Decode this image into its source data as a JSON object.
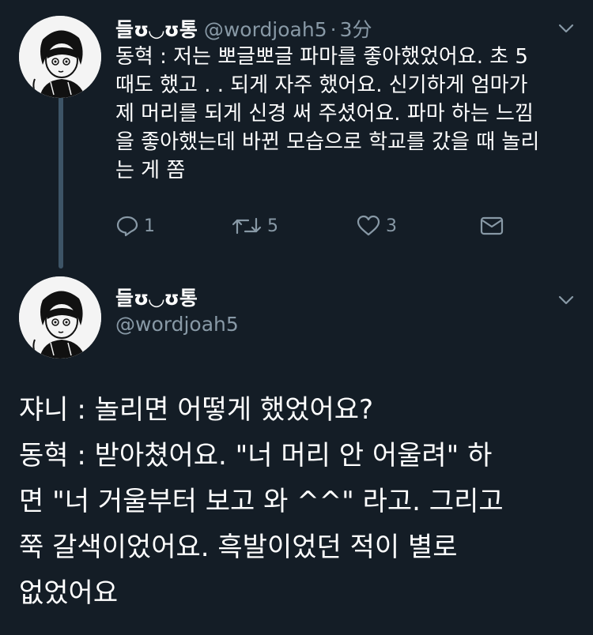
{
  "tweet1": {
    "display_name": "들ʊ◡ʊ통",
    "handle": "@wordjoah5",
    "separator": "·",
    "time": "3分",
    "text_lines": [
      "동혁 : 저는 뽀글뽀글 파마를 좋아했었어요. 초 5",
      "때도 했고 . . 되게 자주 했어요. 신기하게 엄마가",
      "제 머리를 되게 신경 써 주셨어요. 파마 하는 느낌",
      "을 좋아했는데 바뀐 모습으로 학교를 갔을 때 놀리",
      "는 게 쫌"
    ],
    "actions": {
      "reply_icon": "reply-icon",
      "reply_count": "1",
      "retweet_icon": "retweet-icon",
      "retweet_count": "5",
      "like_icon": "heart-icon",
      "like_count": "3",
      "dm_icon": "envelope-icon"
    }
  },
  "tweet2": {
    "display_name": "들ʊ◡ʊ통",
    "handle": "@wordjoah5",
    "text_lines": [
      "쟈니 : 놀리면 어떻게 했었어요?",
      "동혁 : 받아쳤어요. \"너 머리 안 어울려\" 하",
      "면 \"너 거울부터 보고 와 ^^\" 라고. 그리고",
      "쭉 갈색이었어요. 흑발이었던 적이 별로",
      "없었어요"
    ]
  },
  "colors": {
    "background": "#141d26",
    "text": "#ffffff",
    "muted": "#8899a6",
    "thread_line": "#3d5466"
  }
}
